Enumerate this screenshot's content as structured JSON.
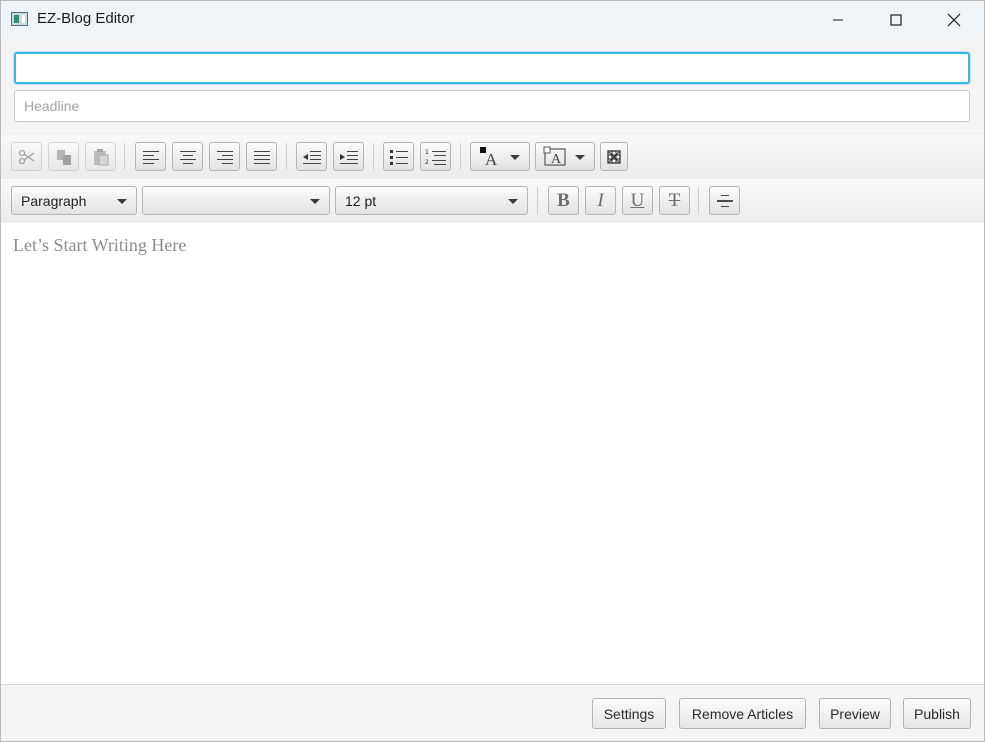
{
  "window": {
    "title": "EZ-Blog Editor",
    "controls": [
      "minimize-icon",
      "maximize-icon",
      "close-icon"
    ]
  },
  "fields": {
    "title_value": "",
    "headline_placeholder": "Headline"
  },
  "toolbar1": {
    "buttons": [
      "cut-icon",
      "copy-icon",
      "paste-icon",
      "align-left-icon",
      "align-center-icon",
      "align-right-icon",
      "align-justify-icon",
      "outdent-icon",
      "indent-icon",
      "bullet-list-icon",
      "numbered-list-icon",
      "text-color-icon",
      "background-color-icon",
      "insert-table-icon"
    ],
    "disabled": [
      "cut-icon",
      "copy-icon",
      "paste-icon"
    ]
  },
  "toolbar2": {
    "paragraph_style": "Paragraph",
    "font_family": "",
    "font_size": "12 pt",
    "bold_glyph": "B",
    "italic_glyph": "I",
    "underline_glyph": "U",
    "strikethrough_glyph": "T"
  },
  "editor": {
    "placeholder": "Let’s Start Writing Here"
  },
  "actions": {
    "settings": "Settings",
    "remove_articles": "Remove Articles",
    "preview": "Preview",
    "publish": "Publish"
  },
  "colors": {
    "focus_border": "#3db6e6",
    "titlebar_bg": "#eff4f9",
    "panel_bg": "#f4f4f4"
  }
}
